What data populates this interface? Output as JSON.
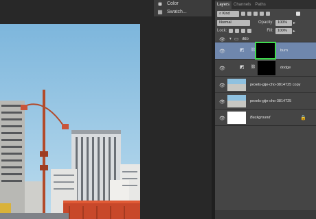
{
  "mini_panel": {
    "items": [
      {
        "label": "Color",
        "icon": "color-icon"
      },
      {
        "label": "Swatch...",
        "icon": "swatches-icon"
      }
    ]
  },
  "layers_panel": {
    "tabs": [
      "Layers",
      "Channels",
      "Paths"
    ],
    "active_tab": "Layers",
    "filter": {
      "label": "Kind"
    },
    "blend_mode": "Normal",
    "opacity": {
      "label": "Opacity:",
      "value": "100%"
    },
    "lock_label": "Lock:",
    "fill": {
      "label": "Fill:",
      "value": "100%"
    },
    "group": {
      "name": "d&b"
    },
    "layers": [
      {
        "name": "burn",
        "type": "mask",
        "selected": true
      },
      {
        "name": "dodge",
        "type": "mask",
        "selected": false
      },
      {
        "name": "pexels-gije-cho-3814725 copy",
        "type": "photo",
        "selected": false
      },
      {
        "name": "pexels-gije-cho-3814725",
        "type": "photo",
        "selected": false
      },
      {
        "name": "Background",
        "type": "white",
        "selected": false
      }
    ]
  },
  "colors": {
    "selected_layer": "#6f87ad",
    "highlight_box": "#3fdc4f"
  }
}
